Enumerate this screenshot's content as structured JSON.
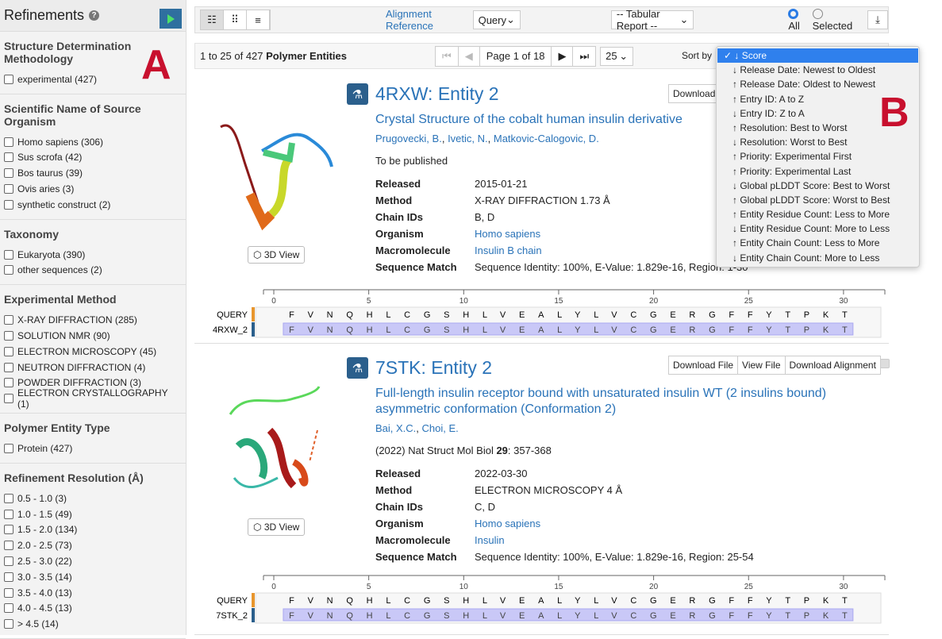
{
  "sidebar": {
    "title": "Refinements",
    "help_icon": "question-circle-icon",
    "run_icon": "play-icon",
    "marker": "A",
    "groups": [
      {
        "title": "Structure Determination Methodology",
        "options": [
          "experimental (427)"
        ]
      },
      {
        "title": "Scientific Name of Source Organism",
        "options": [
          "Homo sapiens (306)",
          "Sus scrofa (42)",
          "Bos taurus (39)",
          "Ovis aries (3)",
          "synthetic construct (2)"
        ]
      },
      {
        "title": "Taxonomy",
        "options": [
          "Eukaryota (390)",
          "other sequences (2)"
        ]
      },
      {
        "title": "Experimental Method",
        "options": [
          "X-RAY DIFFRACTION (285)",
          "SOLUTION NMR (90)",
          "ELECTRON MICROSCOPY (45)",
          "NEUTRON DIFFRACTION (4)",
          "POWDER DIFFRACTION (3)",
          "ELECTRON CRYSTALLOGRAPHY (1)"
        ]
      },
      {
        "title": "Polymer Entity Type",
        "options": [
          "Protein (427)"
        ]
      },
      {
        "title": "Refinement Resolution (Å)",
        "options": [
          "0.5 - 1.0 (3)",
          "1.0 - 1.5 (49)",
          "1.5 - 2.0 (134)",
          "2.0 - 2.5 (73)",
          "2.5 - 3.0 (22)",
          "3.0 - 3.5 (14)",
          "3.5 - 4.0 (13)",
          "4.0 - 4.5 (13)",
          "> 4.5 (14)"
        ]
      }
    ]
  },
  "toolbar": {
    "alignment_label": "Alignment Reference",
    "alignment_value": "Query",
    "report_value": "-- Tabular Report --",
    "radio_all": "All",
    "radio_selected": "Selected",
    "selected_radio": "All"
  },
  "pager": {
    "count_prefix": "1 to 25 of 427",
    "count_suffix": "Polymer Entities",
    "page_label": "Page 1 of 18",
    "per_page": "25",
    "sort_label": "Sort by"
  },
  "sort_menu": {
    "marker": "B",
    "items": [
      "✓ ↓ Score",
      "↓ Release Date: Newest to Oldest",
      "↑ Release Date: Oldest to Newest",
      "↑ Entry ID: A to Z",
      "↓ Entry ID: Z to A",
      "↑ Resolution: Best to Worst",
      "↓ Resolution: Worst to Best",
      "↑ Priority: Experimental First",
      "↑ Priority: Experimental Last",
      "↓ Global pLDDT Score: Best to Worst",
      "↑ Global pLDDT Score: Worst to Best",
      "↑ Entity Residue Count: Less to More",
      "↓ Entity Residue Count: More to Less",
      "↑ Entity Chain Count: Less to More",
      "↓ Entity Chain Count: More to Less"
    ]
  },
  "detail_labels": {
    "released": "Released",
    "method": "Method",
    "chain_ids": "Chain IDs",
    "organism": "Organism",
    "macromolecule": "Macromolecule",
    "sequence_match": "Sequence Match",
    "view3d": "3D View",
    "download_file": "Download File",
    "view_file": "View File",
    "download_alignment": "Download Alignment",
    "download_short": "Download"
  },
  "entries": [
    {
      "title": "4RXW: Entity 2",
      "description": "Crystal Structure of the cobalt human insulin derivative",
      "authors": [
        "Prugovecki, B.",
        "Ivetic, N.",
        "Matkovic-Calogovic, D."
      ],
      "citation": "To be published",
      "released": "2015-01-21",
      "method": "X-RAY DIFFRACTION 1.73 Å",
      "chain_ids": "B, D",
      "organism": "Homo sapiens",
      "macromolecule": "Insulin B chain",
      "sequence_match": "Sequence Identity: 100%, E-Value: 1.829e-16, Region: 1-30",
      "hit_label": "4RXW_2"
    },
    {
      "title": "7STK: Entity 2",
      "description": "Full-length insulin receptor bound with unsaturated insulin WT (2 insulins bound) asymmetric conformation (Conformation 2)",
      "authors": [
        "Bai, X.C.",
        "Choi, E."
      ],
      "citation_pre": "(2022) Nat Struct Mol Biol ",
      "citation_vol": "29",
      "citation_post": ": 357-368",
      "released": "2022-03-30",
      "method": "ELECTRON MICROSCOPY 4 Å",
      "chain_ids": "C, D",
      "organism": "Homo sapiens",
      "macromolecule": "Insulin",
      "sequence_match": "Sequence Identity: 100%, E-Value: 1.829e-16, Region: 25-54",
      "hit_label": "7STK_2"
    }
  ],
  "alignment": {
    "query_label": "QUERY",
    "sequence": "FVNQHLCGSHLVEALYLVCGERGFFYTPKT",
    "ticks": [
      0,
      5,
      10,
      15,
      20,
      25,
      30
    ],
    "query_color": "#e8962e",
    "hit_color": "#2b5f8c",
    "hit_bg": "#c9c8f7"
  }
}
